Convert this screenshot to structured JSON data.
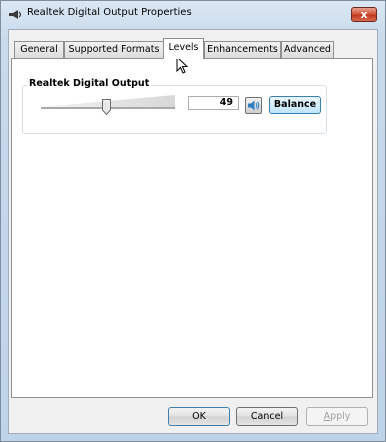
{
  "window": {
    "title": "Realtek Digital Output Properties",
    "close_glyph": "x"
  },
  "tabs": [
    {
      "label": "General",
      "active": false
    },
    {
      "label": "Supported Formats",
      "active": false
    },
    {
      "label": "Levels",
      "active": true
    },
    {
      "label": "Enhancements",
      "active": false
    },
    {
      "label": "Advanced",
      "active": false
    }
  ],
  "levels": {
    "group_label": "Realtek Digital Output",
    "volume_value": "49",
    "volume_fraction": 0.49,
    "mute_icon": "speaker-icon",
    "balance_label": "Balance"
  },
  "buttons": {
    "ok": "OK",
    "cancel": "Cancel",
    "apply_prefix": "A",
    "apply_rest": "pply"
  },
  "colors": {
    "title_gradient_top": "#dbe7f3",
    "close_red": "#c13a20",
    "panel_bg": "#ffffff",
    "balance_blue": "#bee6fd"
  }
}
